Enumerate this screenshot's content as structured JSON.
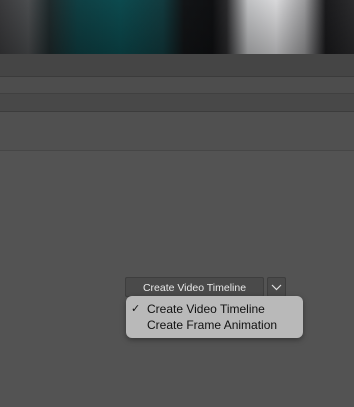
{
  "timeline": {
    "create_button_label": "Create Video Timeline"
  },
  "menu": {
    "items": [
      {
        "label": "Create Video Timeline",
        "checked": true,
        "check_glyph": "✓"
      },
      {
        "label": "Create Frame Animation",
        "checked": false,
        "check_glyph": ""
      }
    ]
  },
  "icons": {
    "dropdown": "chevron-down-icon",
    "checkmark": "checkmark-icon"
  }
}
